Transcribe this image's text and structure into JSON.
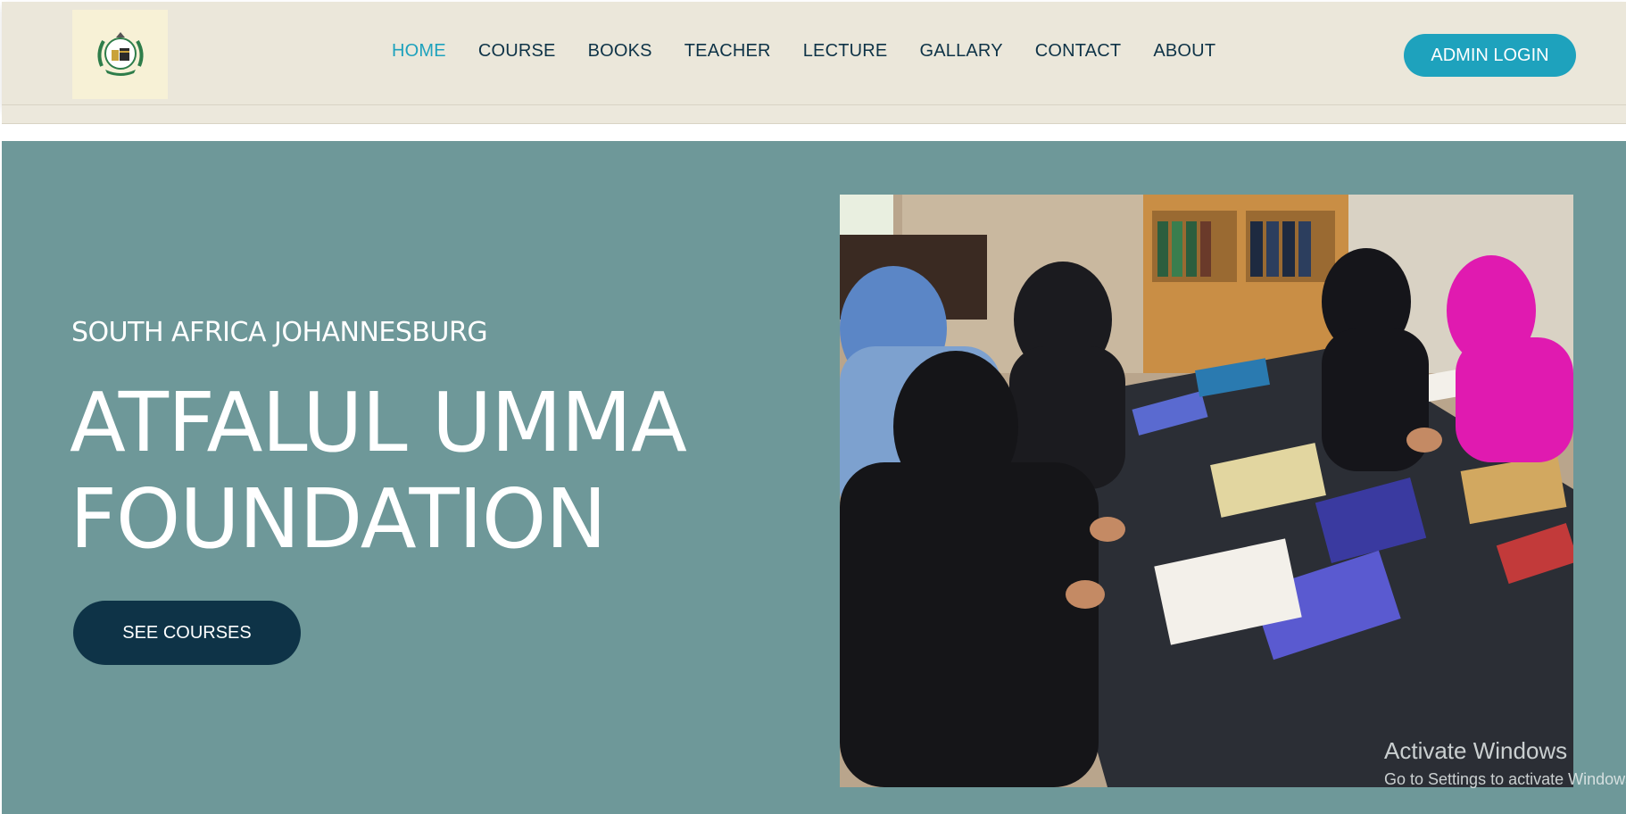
{
  "header": {
    "logo_alt": "Atfalul Umma Foundation logo",
    "nav": [
      {
        "label": "HOME",
        "active": true
      },
      {
        "label": "COURSE",
        "active": false
      },
      {
        "label": "BOOKS",
        "active": false
      },
      {
        "label": "TEACHER",
        "active": false
      },
      {
        "label": "LECTURE",
        "active": false
      },
      {
        "label": "GALLARY",
        "active": false
      },
      {
        "label": "CONTACT",
        "active": false
      },
      {
        "label": "ABOUT",
        "active": false
      }
    ],
    "admin_login_label": "ADMIN LOGIN"
  },
  "hero": {
    "subtitle": "SOUTH AFRICA JOHANNESBURG",
    "title_line1": "ATFALUL UMMA",
    "title_line2": "FOUNDATION",
    "cta_label": "SEE COURSES",
    "image_description": "students studying"
  },
  "watermark": {
    "line1": "Activate Windows",
    "line2": "Go to Settings to activate Windows."
  },
  "colors": {
    "header_bg": "#ebe7da",
    "hero_bg": "#6e9899",
    "accent": "#1ea2bd",
    "dark": "#0e3347"
  }
}
